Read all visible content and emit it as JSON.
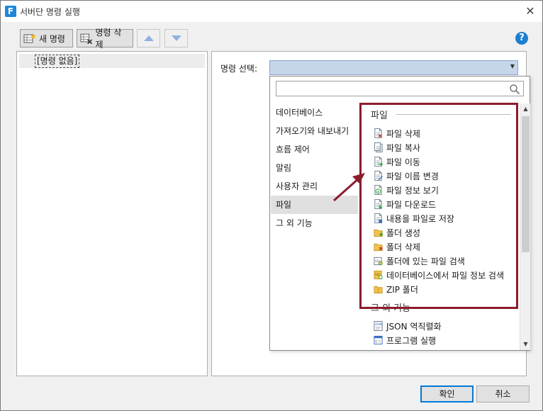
{
  "window": {
    "title": "서버단 명령 실행",
    "app_icon_letter": "F"
  },
  "toolbar": {
    "new_command": "새 명령",
    "delete_command": "명령 삭제"
  },
  "left_tree": {
    "empty_item": "[명령 없음]"
  },
  "command_select": {
    "label": "명령 선택:",
    "value": ""
  },
  "dropdown": {
    "search_placeholder": "",
    "categories": [
      {
        "label": "데이터베이스",
        "selected": false
      },
      {
        "label": "가져오기와 내보내기",
        "selected": false
      },
      {
        "label": "흐름 제어",
        "selected": false
      },
      {
        "label": "알림",
        "selected": false
      },
      {
        "label": "사용자 관리",
        "selected": false
      },
      {
        "label": "파일",
        "selected": true
      },
      {
        "label": "그 외 기능",
        "selected": false
      }
    ],
    "groups": [
      {
        "title": "파일",
        "items": [
          {
            "label": "파일 삭제",
            "icon": "file-delete-icon"
          },
          {
            "label": "파일 복사",
            "icon": "file-copy-icon"
          },
          {
            "label": "파일 이동",
            "icon": "file-move-icon"
          },
          {
            "label": "파일 이름 변경",
            "icon": "file-rename-icon"
          },
          {
            "label": "파일 정보 보기",
            "icon": "file-info-icon"
          },
          {
            "label": "파일 다운로드",
            "icon": "file-download-icon"
          },
          {
            "label": "내용을 파일로 저장",
            "icon": "file-save-icon"
          },
          {
            "label": "폴더 생성",
            "icon": "folder-create-icon"
          },
          {
            "label": "폴더 삭제",
            "icon": "folder-delete-icon"
          },
          {
            "label": "폴더에 있는 파일 검색",
            "icon": "folder-search-icon"
          },
          {
            "label": "데이터베이스에서 파일 정보 검색",
            "icon": "db-file-search-icon"
          },
          {
            "label": "ZIP 폴더",
            "icon": "zip-folder-icon"
          }
        ]
      },
      {
        "title": "그 외 기능",
        "items": [
          {
            "label": "JSON 역직렬화",
            "icon": "json-icon"
          },
          {
            "label": "프로그램 실행",
            "icon": "program-run-icon"
          }
        ]
      }
    ]
  },
  "footer": {
    "ok": "확인",
    "cancel": "취소"
  },
  "colors": {
    "highlight_border": "#8b1c2c",
    "select_fill": "#c6d6ea",
    "help_blue": "#1e7fd0",
    "folder_yellow": "#f2c14e"
  }
}
